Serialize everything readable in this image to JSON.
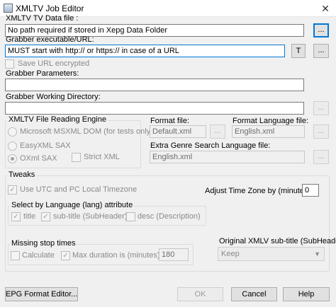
{
  "window": {
    "title": "XMLTV Job Editor",
    "close_glyph": "✕",
    "icon": "app-icon"
  },
  "data_file": {
    "label": "XMLTV TV Data file :",
    "value": "No path required if stored in Xepg Data Folder",
    "browse": "..."
  },
  "grabber": {
    "label": "Grabber executable/URL:",
    "value": "MUST start with http:// or https:// in case of a URL",
    "t_button": "T",
    "browse": "...",
    "save_encrypted": "Save URL encrypted",
    "params_label": "Grabber Parameters:",
    "params_value": "",
    "workdir_label": "Grabber Working Directory:",
    "workdir_value": "",
    "workdir_browse": "..."
  },
  "engine": {
    "label": "XMLTV File Reading Engine",
    "options": [
      "Microsoft MSXML DOM (for tests only)",
      "EasyXML SAX",
      "OXml SAX"
    ],
    "selected": "OXml SAX",
    "strict": "Strict XML"
  },
  "format": {
    "file_label": "Format file:",
    "file_value": "Default.xml",
    "file_browse": "...",
    "lang_label": "Format Language file:",
    "lang_value": "English.xml",
    "lang_browse": "...",
    "extra_label": "Extra Genre Search Language file:",
    "extra_value": "English.xml",
    "extra_browse": "..."
  },
  "tweaks": {
    "label": "Tweaks",
    "utc": "Use UTC and PC Local  Timezone",
    "adjust_label": "Adjust Time Zone by (minutes):",
    "adjust_value": "0",
    "lang_group": "Select by Language (lang) attribute",
    "lang_title": "title",
    "lang_subtitle": "sub-title (SubHeader)",
    "lang_desc": "desc (Description)",
    "missing_group": "Missing stop times",
    "calculate": "Calculate",
    "max_duration": "Max duration is (minutes):",
    "max_value": "180",
    "orig_label": "Original XMLV sub-title (SubHeader):",
    "orig_value": "Keep"
  },
  "footer": {
    "epg": "EPG Format Editor...",
    "ok": "OK",
    "cancel": "Cancel",
    "help": "Help"
  }
}
